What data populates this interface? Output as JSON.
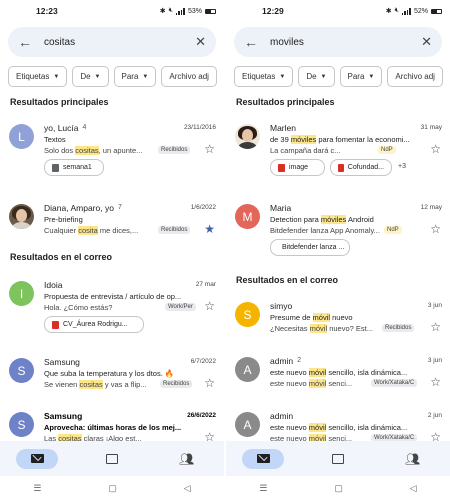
{
  "left": {
    "status": {
      "time": "12:23",
      "battery": "53%"
    },
    "search": {
      "query": "cositas"
    },
    "chips": [
      "Etiquetas",
      "De",
      "Para",
      "Archivo adj"
    ],
    "section1": "Resultados principales",
    "section2": "Resultados en el correo",
    "rows": [
      {
        "avatar": "L",
        "color": "#8fa1d6",
        "sender": "yo, Lucía",
        "count": "4",
        "date": "23/11/2016",
        "subject": "Textos",
        "snippet_pre": "Solo dos ",
        "snippet_hl": "cositas",
        "snippet_post": ", un apunte...",
        "label": "Recibidos",
        "attachment": "semana1",
        "starred": false
      },
      {
        "avatar": "",
        "color": "",
        "sender": "Diana, Amparo, yo",
        "count": "7",
        "date": "1/6/2022",
        "subject": "Pre-briefing",
        "snippet_pre": "Cualquier ",
        "snippet_hl": "cosita",
        "snippet_post": " me dices,...",
        "label": "Recibidos",
        "starred": true
      },
      {
        "avatar": "I",
        "color": "#7cc45b",
        "sender": "Idoia",
        "count": "",
        "date": "27 mar",
        "subject": "Propuesta de entrevista / artículo de op...",
        "snippet_pre": "Hola. ¿Cómo estás?",
        "snippet_hl": "",
        "snippet_post": "",
        "label": "Work/Per",
        "attachment": "CV_Áurea Rodrigu...",
        "starred": false
      },
      {
        "avatar": "S",
        "color": "#6e82c8",
        "sender": "Samsung",
        "count": "",
        "date": "6/7/2022",
        "subject": "Que suba la temperatura y los dtos. 🔥",
        "snippet_pre": "Se vienen ",
        "snippet_hl": "cositas",
        "snippet_post": " y vas a flip...",
        "label": "Recibidos",
        "starred": false
      },
      {
        "avatar": "S",
        "color": "#6e82c8",
        "sender": "Samsung",
        "count": "",
        "date": "26/6/2022",
        "subject": "Aprovecha: últimas horas de los mej...",
        "snippet_pre": "Las ",
        "snippet_hl": "cositas",
        "snippet_post": " claras ¡Algo est...",
        "label": "",
        "starred": false,
        "bold": true
      }
    ]
  },
  "right": {
    "status": {
      "time": "12:29",
      "battery": "52%"
    },
    "search": {
      "query": "moviles"
    },
    "chips": [
      "Etiquetas",
      "De",
      "Para",
      "Archivo adj"
    ],
    "section1": "Resultados principales",
    "section2": "Resultados en el correo",
    "rows": [
      {
        "avatar": "",
        "color": "",
        "sender": "Marlen",
        "count": "",
        "date": "31 may",
        "subject_pre": "de 39 ",
        "subject_hl": "móviles",
        "subject_post": " para fomentar la economi...",
        "snippet_pre": "La campaña dará c...",
        "snippet_hl": "",
        "snippet_post": "",
        "label": "NdP",
        "attachment": "image",
        "attachment2": "Cofundad...",
        "more": "+3",
        "starred": false
      },
      {
        "avatar": "M",
        "color": "#e2675a",
        "sender": "Maria",
        "count": "",
        "date": "12 may",
        "subject_pre": "Detection para ",
        "subject_hl": "móviles",
        "subject_post": " Android",
        "snippet_pre": "Bitdefender lanza App Anomaly...",
        "snippet_hl": "",
        "snippet_post": "",
        "label": "NdP",
        "attachment": "Bitdefender lanza ...",
        "starred": false
      },
      {
        "avatar": "S",
        "color": "#f4b400",
        "sender": "simyo",
        "count": "",
        "date": "3 jun",
        "subject_pre": "Presume de ",
        "subject_hl": "móvil",
        "subject_post": " nuevo",
        "snippet_pre": "¿Necesitas ",
        "snippet_hl": "móvil",
        "snippet_post": " nuevo? Est...",
        "label": "Recibidos",
        "starred": false
      },
      {
        "avatar": "A",
        "color": "#8a8a8a",
        "sender": "admin",
        "count": "2",
        "date": "3 jun",
        "subject_pre": "este nuevo ",
        "subject_hl": "móvil",
        "subject_post": " sencillo, isla dinámica...",
        "snippet_pre": "este nuevo ",
        "snippet_hl": "móvil",
        "snippet_post": " senci...",
        "label": "Work/Xataka/C",
        "starred": false
      },
      {
        "avatar": "A",
        "color": "#8a8a8a",
        "sender": "admin",
        "count": "",
        "date": "2 jun",
        "subject_pre": "este nuevo ",
        "subject_hl": "móvil",
        "subject_post": " sencillo, isla dinámica...",
        "snippet_pre": "este nuevo ",
        "snippet_hl": "móvil",
        "snippet_post": " senci...",
        "label": "Work/Xataka/C",
        "starred": false
      }
    ]
  }
}
